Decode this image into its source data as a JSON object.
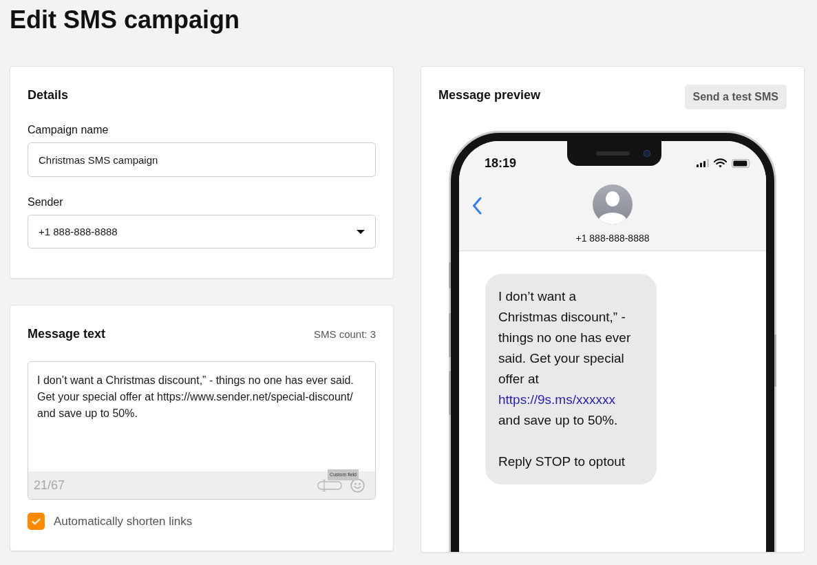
{
  "page": {
    "title": "Edit SMS campaign"
  },
  "details": {
    "title": "Details",
    "fields": [
      {
        "kind": "text",
        "label": "Campaign name",
        "value": "Christmas SMS campaign"
      },
      {
        "kind": "select",
        "label": "Sender",
        "value": "+1 888-888-8888"
      }
    ]
  },
  "message_text": {
    "title": "Message text",
    "sms_count": "SMS count: 3",
    "value": "I don’t want a Christmas discount,” - things no one has ever said. Get your special offer at https://www.sender.net/special-discount/ and save up to 50%.",
    "char_count": "21/67",
    "tooltip": "Custom field",
    "options": [
      {
        "label": "Automatically shorten links",
        "checked": true
      }
    ]
  },
  "preview": {
    "title": "Message preview",
    "button": "Send a test SMS",
    "phone": {
      "time": "18:19",
      "contact": "+1 888-888-8888",
      "bubble": {
        "text": "I don’t want a Christmas discount,” - things no one has ever said. Get your special offer at",
        "link": "https://9s.ms/xxxxxx",
        "text_after": "and save up to 50%.",
        "footer": "Reply STOP to optout"
      }
    }
  }
}
